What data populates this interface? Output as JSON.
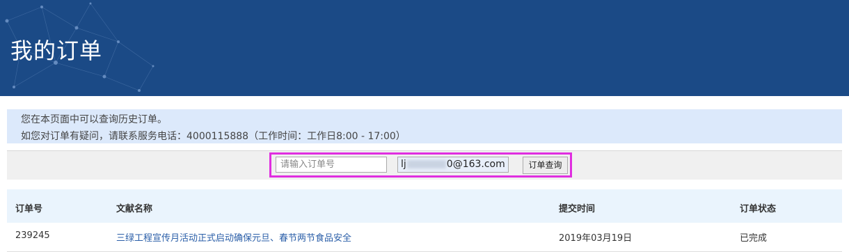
{
  "header": {
    "title": "我的订单"
  },
  "notice": {
    "line1": "您在本页面中可以查询历史订单。",
    "line2": "如您对订单有疑问，请联系服务电话：4000115888（工作时间：工作日8:00 - 17:00）"
  },
  "search": {
    "order_placeholder": "请输入订单号",
    "email_prefix": "lj",
    "email_suffix": "0@163.com",
    "query_label": "订单查询"
  },
  "table": {
    "columns": [
      "订单号",
      "文献名称",
      "提交时间",
      "订单状态"
    ],
    "rows": [
      {
        "order_no": "239245",
        "doc_name": "三绿工程宣传月活动正式启动确保元旦、春节两节食品安全",
        "submit_time": "2019年03月19日",
        "status": "已完成"
      }
    ]
  },
  "colors": {
    "header_bg": "#1b4a86",
    "notice_bg": "#dce9fb",
    "highlight": "#e02ee0",
    "link": "#2a5ea8"
  }
}
